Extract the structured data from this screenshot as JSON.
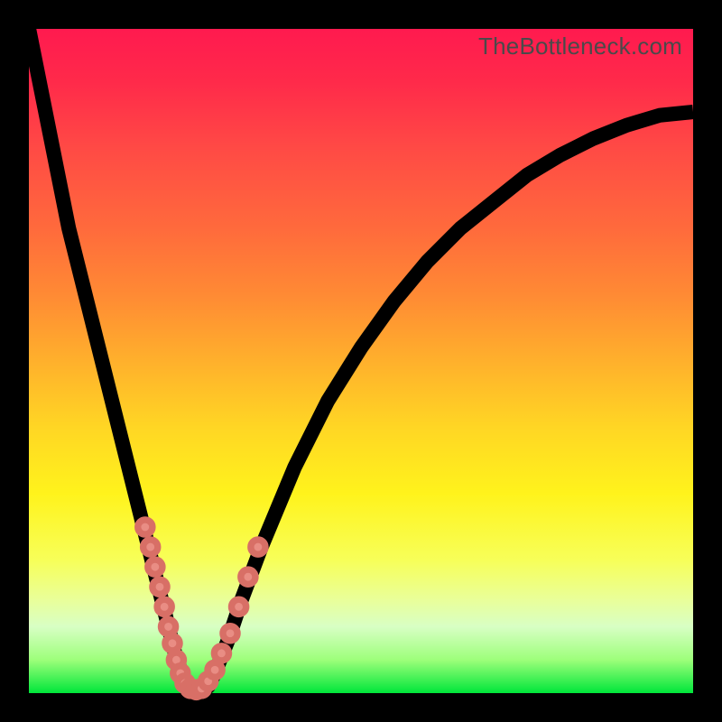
{
  "watermark": "TheBottleneck.com",
  "colors": {
    "gradient_top": "#ff1a4f",
    "gradient_mid": "#fff31c",
    "gradient_bottom": "#00e63a",
    "frame": "#000000",
    "curve": "#000000",
    "bead": "#e98d84"
  },
  "chart_data": {
    "type": "line",
    "title": "",
    "xlabel": "",
    "ylabel": "",
    "xlim": [
      0,
      100
    ],
    "ylim": [
      0,
      100
    ],
    "grid": false,
    "legend": false,
    "series": [
      {
        "name": "curve",
        "x": [
          0,
          2,
          4,
          6,
          8,
          10,
          12,
          14,
          16,
          18,
          20,
          21,
          22,
          23,
          24,
          25,
          26,
          27,
          28,
          30,
          32,
          35,
          40,
          45,
          50,
          55,
          60,
          65,
          70,
          75,
          80,
          85,
          90,
          95,
          100
        ],
        "y": [
          100,
          90,
          80,
          70,
          62,
          54,
          46,
          38,
          30,
          22,
          14,
          10,
          6,
          3,
          1,
          0,
          0,
          1,
          3,
          8,
          14,
          22,
          34,
          44,
          52,
          59,
          65,
          70,
          74,
          78,
          81,
          83.5,
          85.5,
          87,
          87.5
        ]
      }
    ],
    "markers": {
      "name": "beads",
      "x": [
        17.5,
        18.3,
        19.0,
        19.7,
        20.4,
        21.0,
        21.6,
        22.2,
        22.8,
        23.5,
        24.3,
        25.2,
        26.0,
        27.0,
        28.0,
        29.0,
        30.3,
        31.6,
        33.0,
        34.5
      ],
      "y": [
        25,
        22,
        19,
        16,
        13,
        10,
        7.5,
        5,
        3,
        1.5,
        0.7,
        0.5,
        0.7,
        1.8,
        3.5,
        6,
        9,
        13,
        17.5,
        22
      ],
      "radius": 1.1
    }
  }
}
